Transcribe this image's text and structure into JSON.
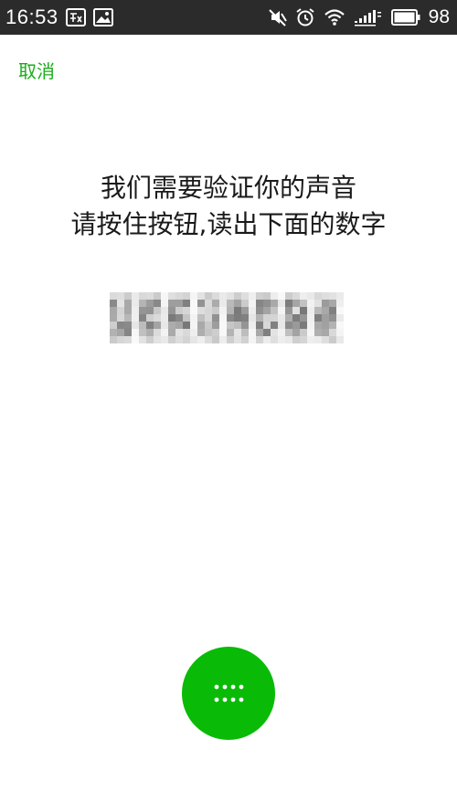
{
  "status_bar": {
    "time": "16:53",
    "battery_level": "98",
    "left_icons": [
      "notification-badge-icon",
      "image-icon"
    ],
    "right_icons": [
      "mute-icon",
      "alarm-icon",
      "wifi-icon",
      "signal-icon",
      "battery-icon"
    ]
  },
  "header": {
    "cancel_label": "取消"
  },
  "instruction": {
    "line1": "我们需要验证你的声音",
    "line2": "请按住按钮,读出下面的数字"
  },
  "digits": {
    "blurred": true
  },
  "record_button": {
    "icon": "dots-grid-icon"
  },
  "colors": {
    "accent": "#1aad19",
    "button": "#09bb07",
    "status_bar": "#2b2b2b",
    "text": "#1a1a1a"
  }
}
